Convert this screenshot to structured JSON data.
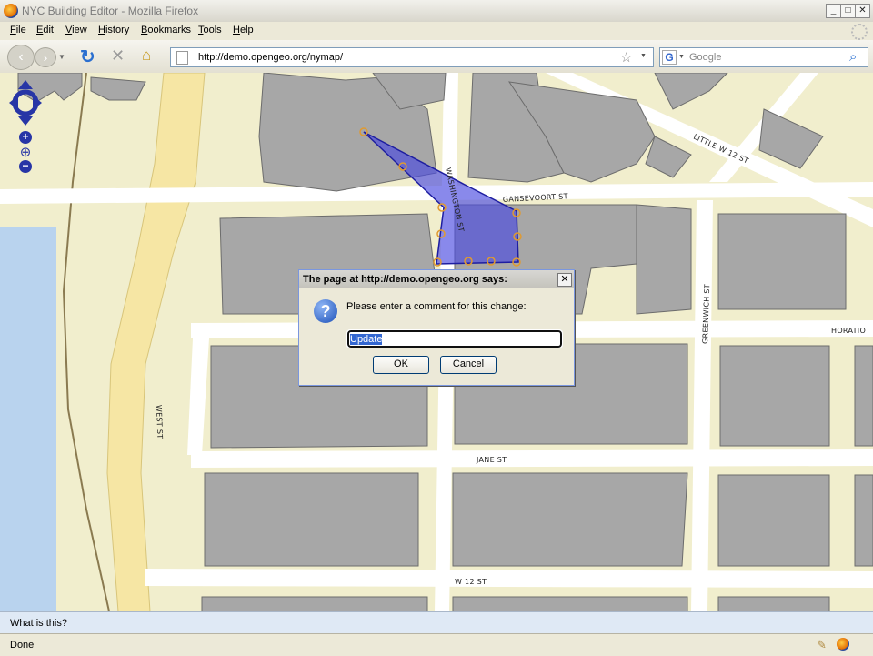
{
  "window": {
    "title": "NYC Building Editor - Mozilla Firefox"
  },
  "menu": [
    "File",
    "Edit",
    "View",
    "History",
    "Bookmarks",
    "Tools",
    "Help"
  ],
  "menu_access_keys": [
    "F",
    "E",
    "V",
    "H",
    "B",
    "T",
    "H"
  ],
  "nav": {
    "url": "http://demo.opengeo.org/nymap/",
    "search_placeholder": "Google"
  },
  "map": {
    "streets": {
      "little_w12": "LITTLE W 12 ST",
      "gansevoort": "GANSEVOORT ST",
      "washington": "WASHINGTON ST",
      "greenwich": "GREENWICH ST",
      "horatio": "HORATIO",
      "west": "WEST ST",
      "jane": "JANE ST",
      "w12": "W 12 ST"
    },
    "colors": {
      "land": "#f1eecd",
      "water": "#b9d3ee",
      "highway": "#f6e6a4",
      "building": "#a7a7a7",
      "edit_polygon": "#3a3ad6",
      "vertex": "#f0a030"
    }
  },
  "dialog": {
    "title": "The page at http://demo.opengeo.org says:",
    "message": "Please enter a comment for this change:",
    "input_value": "Update",
    "ok": "OK",
    "cancel": "Cancel"
  },
  "infobar": {
    "text": "What is this?"
  },
  "status": {
    "text": "Done"
  }
}
